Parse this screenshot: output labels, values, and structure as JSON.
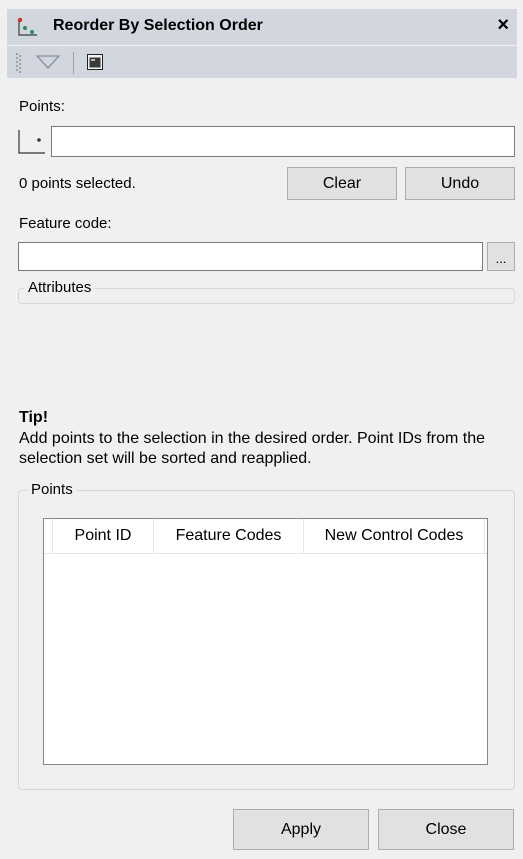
{
  "window": {
    "title": "Reorder By Selection Order",
    "close_glyph": "×"
  },
  "toolbar": {
    "dropdown_icon": "dropdown-triangle-icon",
    "window_icon": "command-window-icon"
  },
  "points": {
    "label": "Points:",
    "input_value": "",
    "status": "0 points selected.",
    "clear_label": "Clear",
    "undo_label": "Undo"
  },
  "feature_code": {
    "label": "Feature code:",
    "input_value": "",
    "browse_label": "..."
  },
  "attributes": {
    "legend": "Attributes"
  },
  "tip": {
    "title": "Tip!",
    "text": "Add points to the selection in the desired order. Point IDs from the selection set will be sorted and reapplied."
  },
  "points_group": {
    "legend": "Points",
    "columns": [
      "Point ID",
      "Feature Codes",
      "New Control Codes"
    ],
    "rows": []
  },
  "footer": {
    "apply_label": "Apply",
    "close_label": "Close"
  }
}
